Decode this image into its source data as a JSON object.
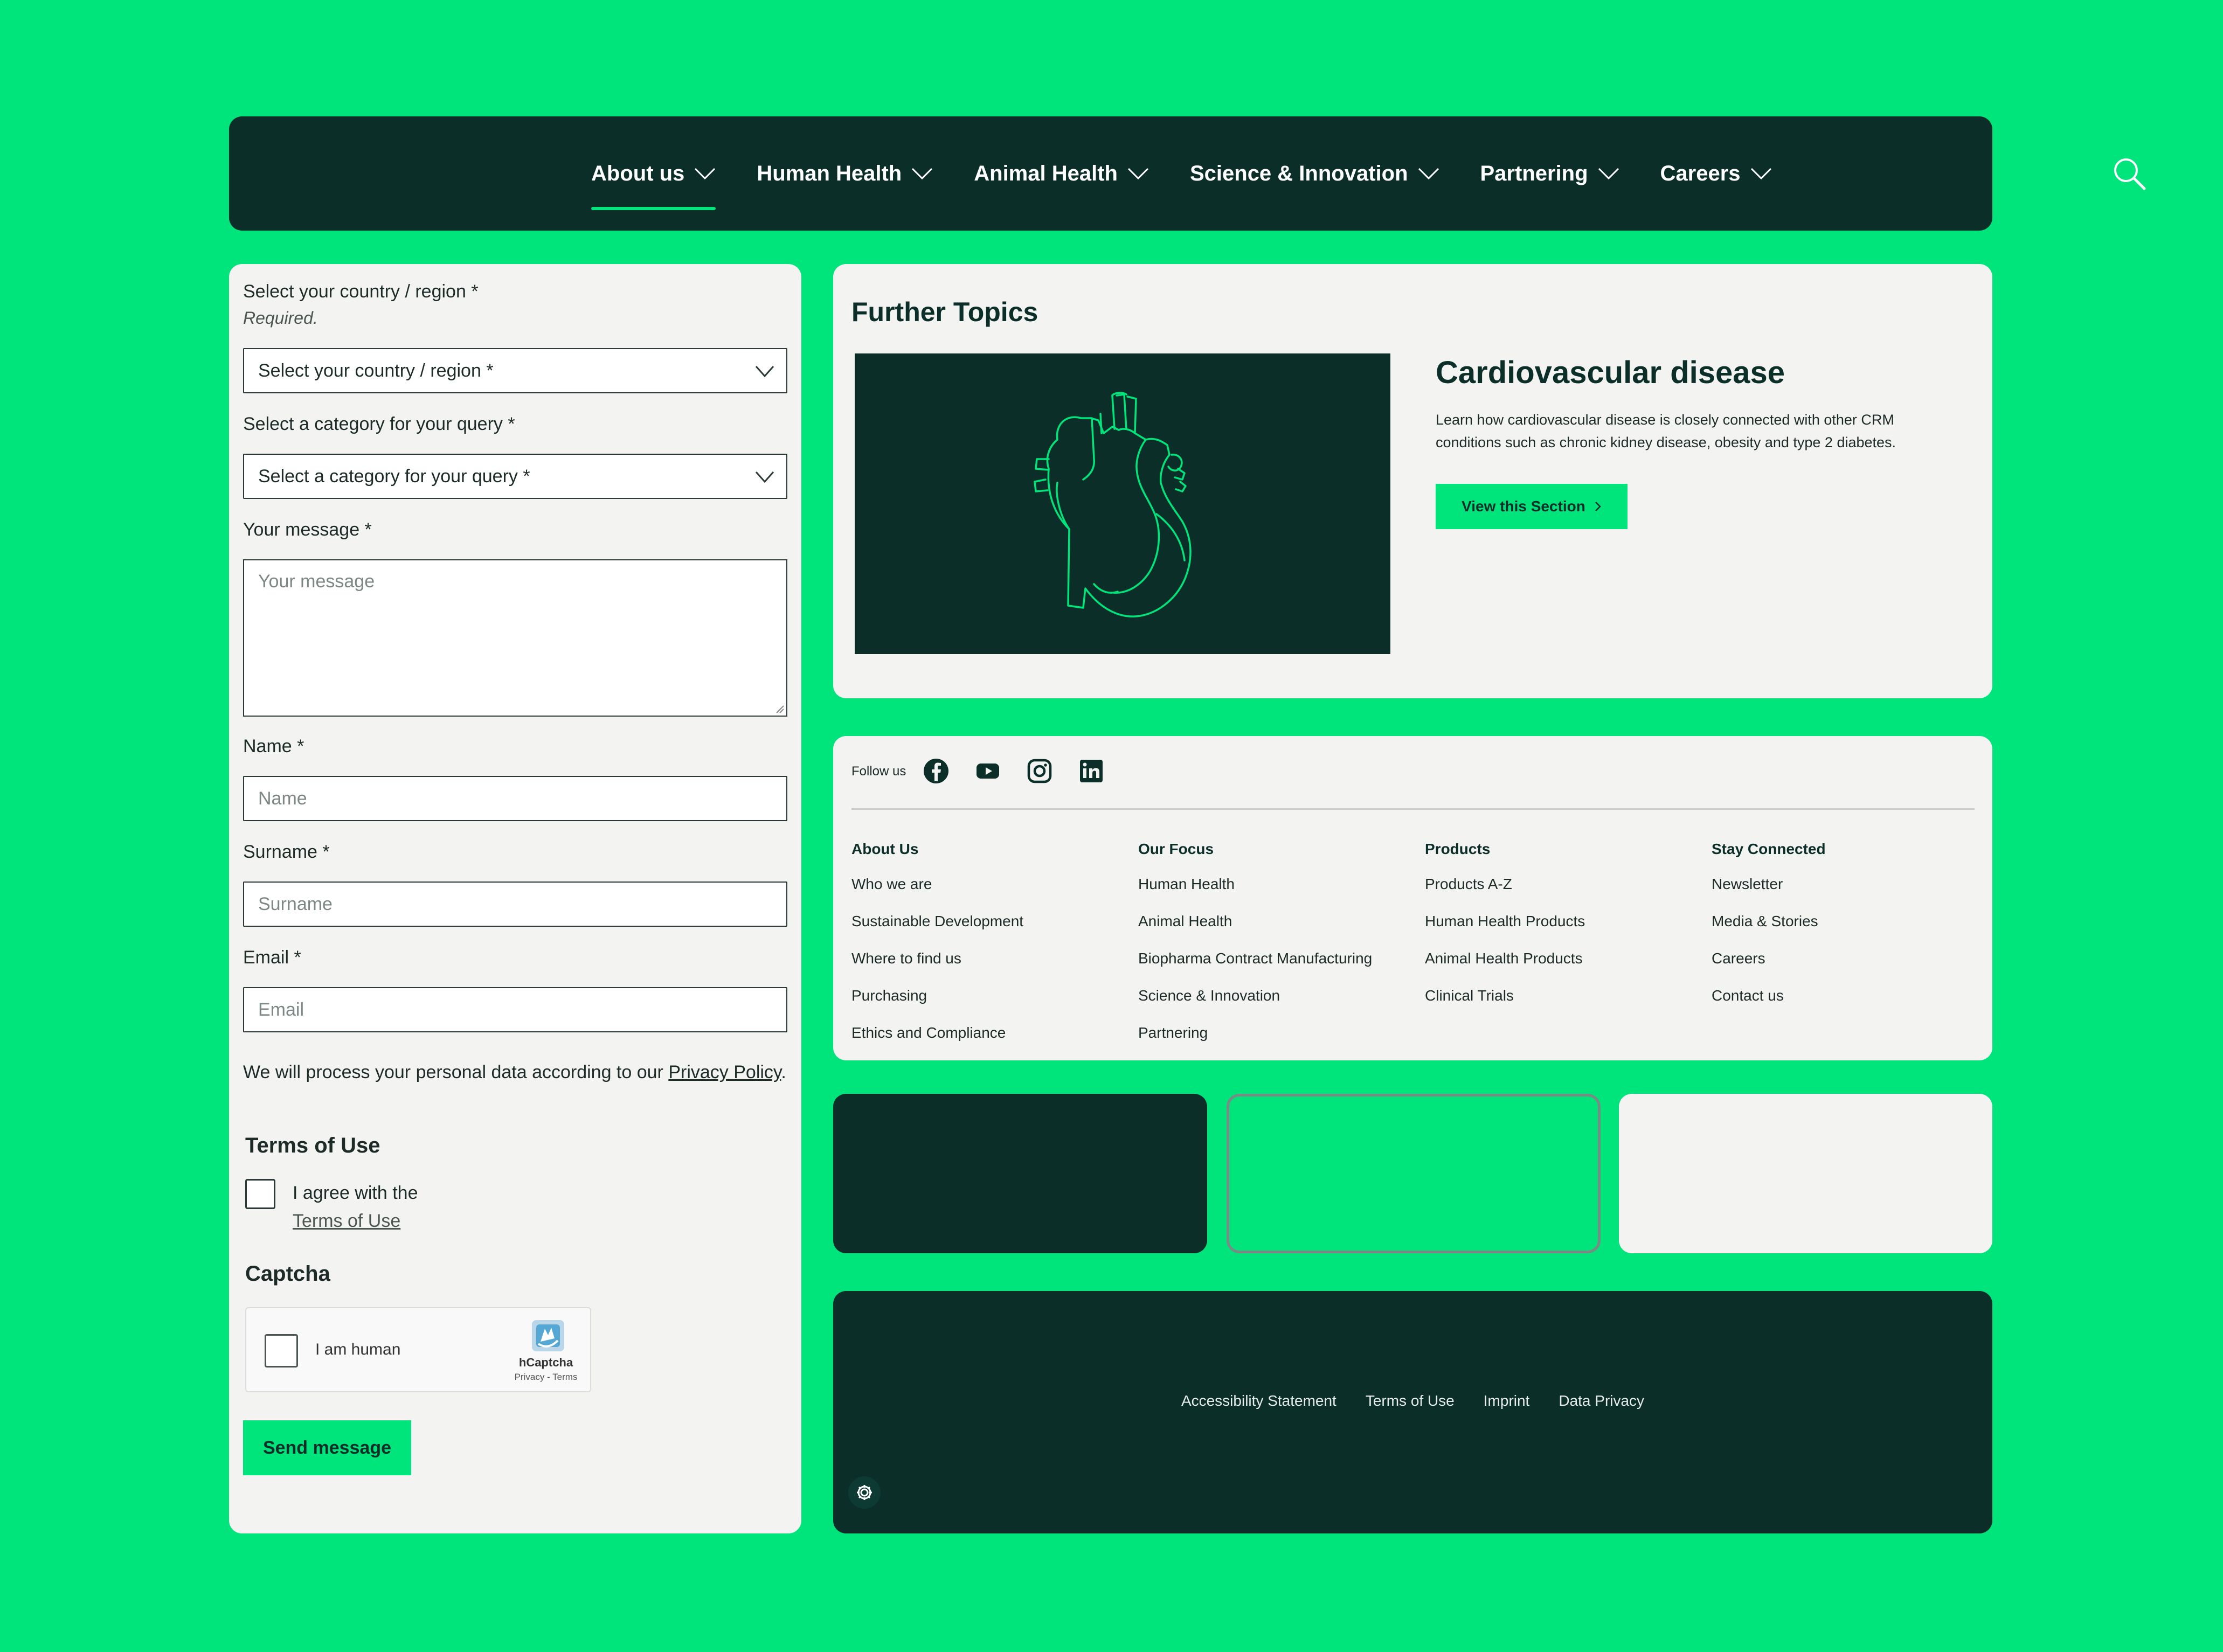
{
  "nav": {
    "items": [
      {
        "label": "About us",
        "active": true
      },
      {
        "label": "Human Health",
        "active": false
      },
      {
        "label": "Animal Health",
        "active": false
      },
      {
        "label": "Science & Innovation",
        "active": false
      },
      {
        "label": "Partnering",
        "active": false
      },
      {
        "label": "Careers",
        "active": false
      }
    ],
    "search_icon": "search-icon"
  },
  "form": {
    "country_label": "Select your country / region *",
    "required_text": "Required.",
    "country_select": "Select your country / region *",
    "category_label": "Select a category for your query *",
    "category_select": "Select a category for your query *",
    "message_label": "Your message *",
    "message_placeholder": "Your message",
    "name_label": "Name *",
    "name_placeholder": "Name",
    "surname_label": "Surname *",
    "surname_placeholder": "Surname",
    "email_label": "Email *",
    "email_placeholder": "Email",
    "privacy_prefix": "We will process your personal data according to our ",
    "privacy_link": "Privacy Policy",
    "privacy_suffix": ".",
    "terms_heading": "Terms of Use",
    "agree_text": "I agree with the",
    "terms_link": "Terms of Use",
    "captcha_heading": "Captcha",
    "captcha_label": "I am human",
    "captcha_brand": "hCaptcha",
    "captcha_sub": "Privacy - Terms",
    "send_label": "Send message"
  },
  "topics": {
    "title": "Further Topics",
    "card_title": "Cardiovascular disease",
    "card_desc": "Learn how cardiovascular disease is closely connected with other CRM conditions such as chronic kidney disease, obesity and type 2 diabetes.",
    "button_label": "View this Section"
  },
  "links": {
    "follow_label": "Follow us",
    "socials": [
      "facebook-icon",
      "youtube-icon",
      "instagram-icon",
      "linkedin-icon"
    ],
    "columns": [
      {
        "heading": "About Us",
        "items": [
          "Who we are",
          "Sustainable Development",
          "Where to find us",
          "Purchasing",
          "Ethics and Compliance"
        ]
      },
      {
        "heading": "Our Focus",
        "items": [
          "Human Health",
          "Animal Health",
          "Biopharma Contract Manufacturing",
          "Science & Innovation",
          "Partnering"
        ]
      },
      {
        "heading": "Products",
        "items": [
          "Products A-Z",
          "Human Health Products",
          "Animal Health Products",
          "Clinical Trials"
        ]
      },
      {
        "heading": "Stay Connected",
        "items": [
          "Newsletter",
          "Media & Stories",
          "Careers",
          "Contact us"
        ]
      }
    ]
  },
  "legal": {
    "items": [
      "Accessibility Statement",
      "Terms of Use",
      "Imprint",
      "Data Privacy"
    ]
  },
  "colors": {
    "brand_green": "#00e47c",
    "dark_green": "#0b2e28",
    "panel_bg": "#f3f3f2"
  }
}
